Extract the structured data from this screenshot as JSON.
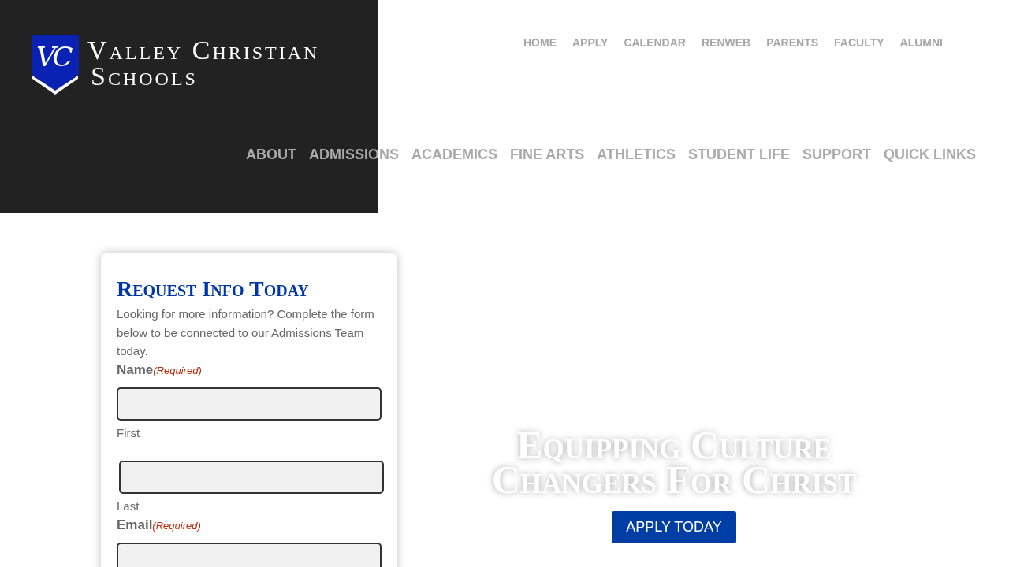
{
  "header": {
    "logo": {
      "monogram": "VC",
      "name_lines": [
        "Valley Christian",
        "Schools"
      ]
    },
    "utility_nav": [
      "HOME",
      "APPLY",
      "CALENDAR",
      "RENWEB",
      "PARENTS",
      "FACULTY",
      "ALUMNI"
    ],
    "main_nav": [
      "ABOUT",
      "ADMISSIONS",
      "ACADEMICS",
      "FINE ARTS",
      "ATHLETICS",
      "STUDENT LIFE",
      "SUPPORT",
      "QUICK LINKS"
    ]
  },
  "request_form": {
    "title": "Request Info Today",
    "intro": "Looking for more information? Complete the form below to be connected to our Admissions Team today.",
    "fields": [
      {
        "kind": "name",
        "label": "Name",
        "required_text": "(Required)",
        "subfields": [
          "First",
          "Last"
        ]
      },
      {
        "kind": "email",
        "label": "Email",
        "required_text": "(Required)"
      }
    ]
  },
  "hero": {
    "heading": "Equipping Culture Changers For Christ",
    "button": "APPLY TODAY"
  }
}
